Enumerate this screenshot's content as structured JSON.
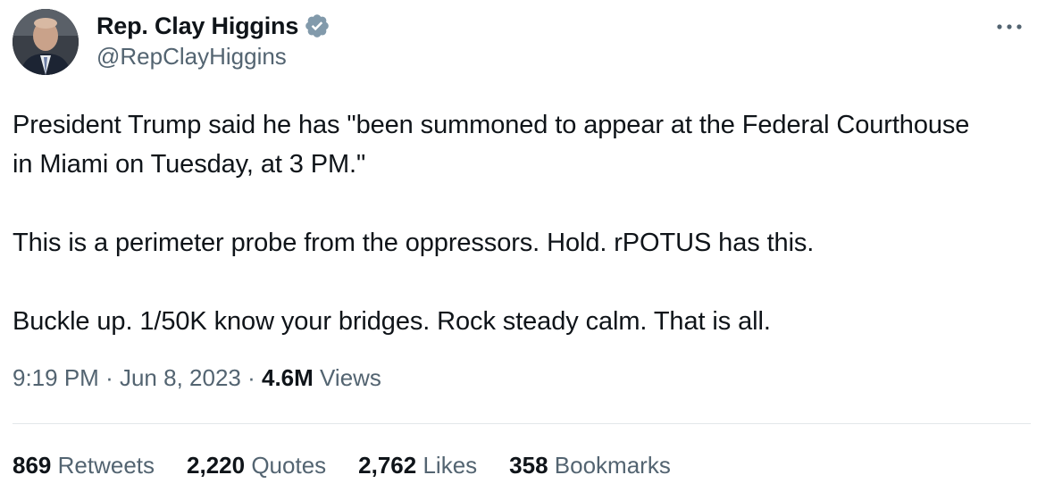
{
  "author": {
    "display_name": "Rep. Clay Higgins",
    "handle": "@RepClayHiggins",
    "verified_icon": "verified-badge-icon",
    "verified_color": "#829aab"
  },
  "menu": {
    "icon": "more-options-icon"
  },
  "tweet": {
    "paragraphs": [
      "President Trump said he has \"been summoned to appear at the Federal Courthouse in Miami on Tuesday, at 3 PM.\"",
      "This is a perimeter probe from the oppressors. Hold. rPOTUS has this.",
      "Buckle up. 1/50K know your bridges. Rock steady calm. That is all."
    ]
  },
  "meta": {
    "time": "9:19 PM",
    "separator": "·",
    "date": "Jun 8, 2023",
    "views_count": "4.6M",
    "views_label": "Views"
  },
  "stats": [
    {
      "count": "869",
      "label": "Retweets"
    },
    {
      "count": "2,220",
      "label": "Quotes"
    },
    {
      "count": "2,762",
      "label": "Likes"
    },
    {
      "count": "358",
      "label": "Bookmarks"
    }
  ],
  "colors": {
    "text": "#0f1419",
    "secondary": "#536471",
    "divider": "#e3e7ea"
  }
}
